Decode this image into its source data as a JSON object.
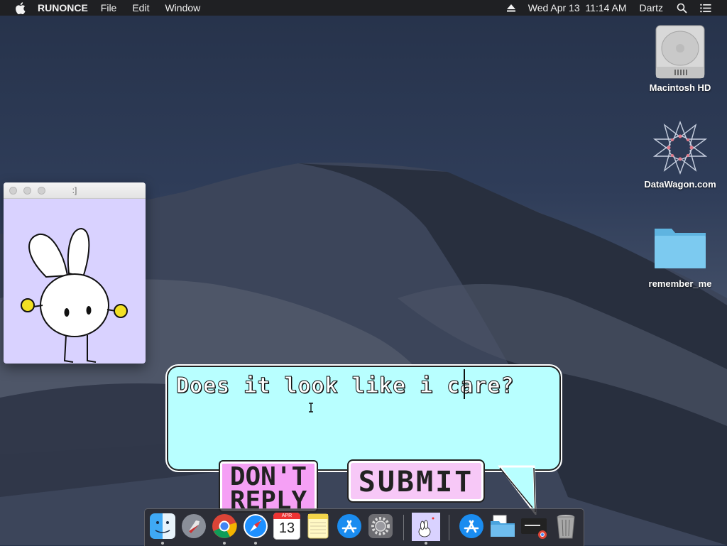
{
  "menubar": {
    "app_name": "RUNONCE",
    "menus": [
      "File",
      "Edit",
      "Window"
    ],
    "date": "Wed Apr 13",
    "time": "11:14 AM",
    "user": "Dartz"
  },
  "desktop_icons": [
    {
      "label": "Macintosh HD",
      "icon": "hard-drive-icon"
    },
    {
      "label": "DataWagon.com",
      "icon": "geometric-star-icon"
    },
    {
      "label": "remember_me",
      "icon": "folder-icon"
    }
  ],
  "mini_window": {
    "title": ":]",
    "background": "#d9d2ff"
  },
  "dialog": {
    "message": "Does it look like i care?",
    "dont_reply_label_line1": "DON'T",
    "dont_reply_label_line2": "REPLY",
    "submit_label": "SUBMIT",
    "bubble_color": "#b8ffff",
    "dont_reply_color": "#f5a0f5",
    "submit_color": "#f7c8f7"
  },
  "dock": {
    "items": [
      "finder-icon",
      "launchpad-icon",
      "chrome-icon",
      "safari-icon",
      "calendar-icon",
      "notes-icon",
      "app-store-icon",
      "system-preferences-icon",
      "bunny-app-icon",
      "app-store-folder-icon",
      "folder-icon",
      "terminal-chrome-icon",
      "trash-icon"
    ],
    "calendar_month": "APR",
    "calendar_day": "13"
  }
}
